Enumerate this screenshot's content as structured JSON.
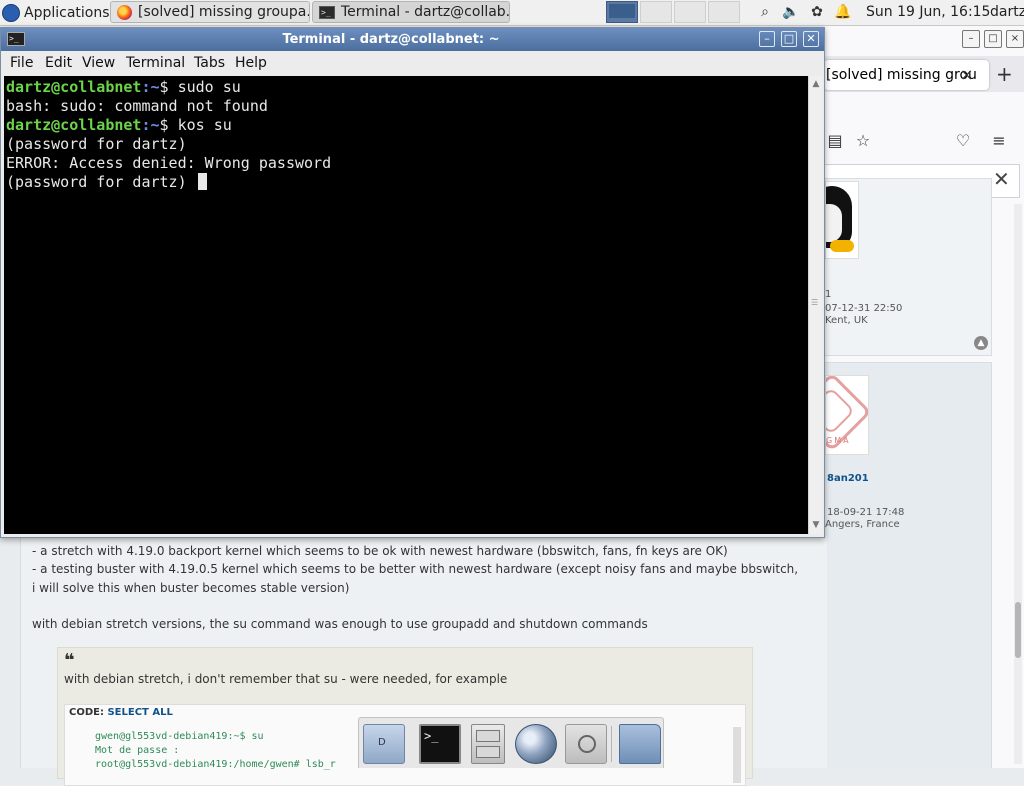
{
  "panel": {
    "applications_label": "Applications",
    "tasks": [
      {
        "title": "[solved] missing groupa..."
      },
      {
        "title": "Terminal - dartz@collab..."
      }
    ],
    "clock": "Sun 19 Jun, 16:15",
    "user": "dartz"
  },
  "browser": {
    "tab_title": "[solved] missing grou",
    "posts": [
      {
        "rank": "1",
        "joined": "07-12-31 22:50",
        "location": "Kent, UK"
      },
      {
        "username": "8an201",
        "joined": "18-09-21 17:48",
        "location": "Angers, France",
        "avatar_text": "GMA"
      }
    ]
  },
  "forum": {
    "lines": [
      "- a stretch with 4.19.0 backport kernel which seems to be ok with newest hardware (bbswitch, fans, fn keys are OK)",
      "- a testing buster with 4.19.0.5 kernel which seems to be better with newest hardware (except noisy fans and maybe bbswitch,",
      "i will solve this when buster becomes stable version)",
      "with debian stretch versions, the su command was enough to use groupadd and shutdown commands"
    ],
    "quote_mark": "❝",
    "quote_text": "with debian stretch, i don't remember that su - were needed, for example",
    "code_label": "CODE:",
    "code_select_all": "SELECT ALL",
    "code_lines": [
      "gwen@gl553vd-debian419:~$ su",
      "Mot de passe :",
      "root@gl553vd-debian419:/home/gwen# lsb_r"
    ]
  },
  "terminal": {
    "window_title": "Terminal - dartz@collabnet: ~",
    "menu": [
      "File",
      "Edit",
      "View",
      "Terminal",
      "Tabs",
      "Help"
    ],
    "user_host": "dartz@collabnet",
    "path": ":~",
    "prompt_symbol": "$",
    "cmd1": "sudo su",
    "out1": "bash: sudo: command not found",
    "cmd2": "kos su",
    "out2": "(password for dartz)",
    "out3": "ERROR: Access denied: Wrong password",
    "out4": "(password for dartz) "
  },
  "dock": {
    "home_label": "D"
  },
  "colors": {
    "prompt_user": "#6bd44a",
    "prompt_path": "#6f8de6",
    "titlebar": "#5a7cad",
    "terminal_bg": "#000000"
  }
}
